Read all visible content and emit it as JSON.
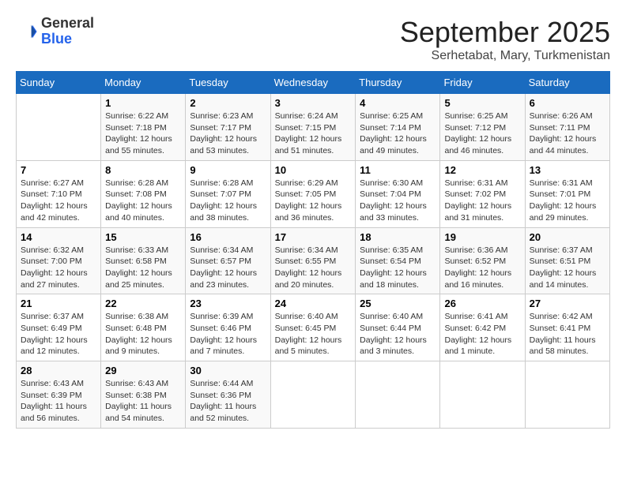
{
  "header": {
    "logo_general": "General",
    "logo_blue": "Blue",
    "month_title": "September 2025",
    "location": "Serhetabat, Mary, Turkmenistan"
  },
  "columns": [
    "Sunday",
    "Monday",
    "Tuesday",
    "Wednesday",
    "Thursday",
    "Friday",
    "Saturday"
  ],
  "weeks": [
    [
      {
        "day": "",
        "info": ""
      },
      {
        "day": "1",
        "info": "Sunrise: 6:22 AM\nSunset: 7:18 PM\nDaylight: 12 hours\nand 55 minutes."
      },
      {
        "day": "2",
        "info": "Sunrise: 6:23 AM\nSunset: 7:17 PM\nDaylight: 12 hours\nand 53 minutes."
      },
      {
        "day": "3",
        "info": "Sunrise: 6:24 AM\nSunset: 7:15 PM\nDaylight: 12 hours\nand 51 minutes."
      },
      {
        "day": "4",
        "info": "Sunrise: 6:25 AM\nSunset: 7:14 PM\nDaylight: 12 hours\nand 49 minutes."
      },
      {
        "day": "5",
        "info": "Sunrise: 6:25 AM\nSunset: 7:12 PM\nDaylight: 12 hours\nand 46 minutes."
      },
      {
        "day": "6",
        "info": "Sunrise: 6:26 AM\nSunset: 7:11 PM\nDaylight: 12 hours\nand 44 minutes."
      }
    ],
    [
      {
        "day": "7",
        "info": "Sunrise: 6:27 AM\nSunset: 7:10 PM\nDaylight: 12 hours\nand 42 minutes."
      },
      {
        "day": "8",
        "info": "Sunrise: 6:28 AM\nSunset: 7:08 PM\nDaylight: 12 hours\nand 40 minutes."
      },
      {
        "day": "9",
        "info": "Sunrise: 6:28 AM\nSunset: 7:07 PM\nDaylight: 12 hours\nand 38 minutes."
      },
      {
        "day": "10",
        "info": "Sunrise: 6:29 AM\nSunset: 7:05 PM\nDaylight: 12 hours\nand 36 minutes."
      },
      {
        "day": "11",
        "info": "Sunrise: 6:30 AM\nSunset: 7:04 PM\nDaylight: 12 hours\nand 33 minutes."
      },
      {
        "day": "12",
        "info": "Sunrise: 6:31 AM\nSunset: 7:02 PM\nDaylight: 12 hours\nand 31 minutes."
      },
      {
        "day": "13",
        "info": "Sunrise: 6:31 AM\nSunset: 7:01 PM\nDaylight: 12 hours\nand 29 minutes."
      }
    ],
    [
      {
        "day": "14",
        "info": "Sunrise: 6:32 AM\nSunset: 7:00 PM\nDaylight: 12 hours\nand 27 minutes."
      },
      {
        "day": "15",
        "info": "Sunrise: 6:33 AM\nSunset: 6:58 PM\nDaylight: 12 hours\nand 25 minutes."
      },
      {
        "day": "16",
        "info": "Sunrise: 6:34 AM\nSunset: 6:57 PM\nDaylight: 12 hours\nand 23 minutes."
      },
      {
        "day": "17",
        "info": "Sunrise: 6:34 AM\nSunset: 6:55 PM\nDaylight: 12 hours\nand 20 minutes."
      },
      {
        "day": "18",
        "info": "Sunrise: 6:35 AM\nSunset: 6:54 PM\nDaylight: 12 hours\nand 18 minutes."
      },
      {
        "day": "19",
        "info": "Sunrise: 6:36 AM\nSunset: 6:52 PM\nDaylight: 12 hours\nand 16 minutes."
      },
      {
        "day": "20",
        "info": "Sunrise: 6:37 AM\nSunset: 6:51 PM\nDaylight: 12 hours\nand 14 minutes."
      }
    ],
    [
      {
        "day": "21",
        "info": "Sunrise: 6:37 AM\nSunset: 6:49 PM\nDaylight: 12 hours\nand 12 minutes."
      },
      {
        "day": "22",
        "info": "Sunrise: 6:38 AM\nSunset: 6:48 PM\nDaylight: 12 hours\nand 9 minutes."
      },
      {
        "day": "23",
        "info": "Sunrise: 6:39 AM\nSunset: 6:46 PM\nDaylight: 12 hours\nand 7 minutes."
      },
      {
        "day": "24",
        "info": "Sunrise: 6:40 AM\nSunset: 6:45 PM\nDaylight: 12 hours\nand 5 minutes."
      },
      {
        "day": "25",
        "info": "Sunrise: 6:40 AM\nSunset: 6:44 PM\nDaylight: 12 hours\nand 3 minutes."
      },
      {
        "day": "26",
        "info": "Sunrise: 6:41 AM\nSunset: 6:42 PM\nDaylight: 12 hours\nand 1 minute."
      },
      {
        "day": "27",
        "info": "Sunrise: 6:42 AM\nSunset: 6:41 PM\nDaylight: 11 hours\nand 58 minutes."
      }
    ],
    [
      {
        "day": "28",
        "info": "Sunrise: 6:43 AM\nSunset: 6:39 PM\nDaylight: 11 hours\nand 56 minutes."
      },
      {
        "day": "29",
        "info": "Sunrise: 6:43 AM\nSunset: 6:38 PM\nDaylight: 11 hours\nand 54 minutes."
      },
      {
        "day": "30",
        "info": "Sunrise: 6:44 AM\nSunset: 6:36 PM\nDaylight: 11 hours\nand 52 minutes."
      },
      {
        "day": "",
        "info": ""
      },
      {
        "day": "",
        "info": ""
      },
      {
        "day": "",
        "info": ""
      },
      {
        "day": "",
        "info": ""
      }
    ]
  ]
}
